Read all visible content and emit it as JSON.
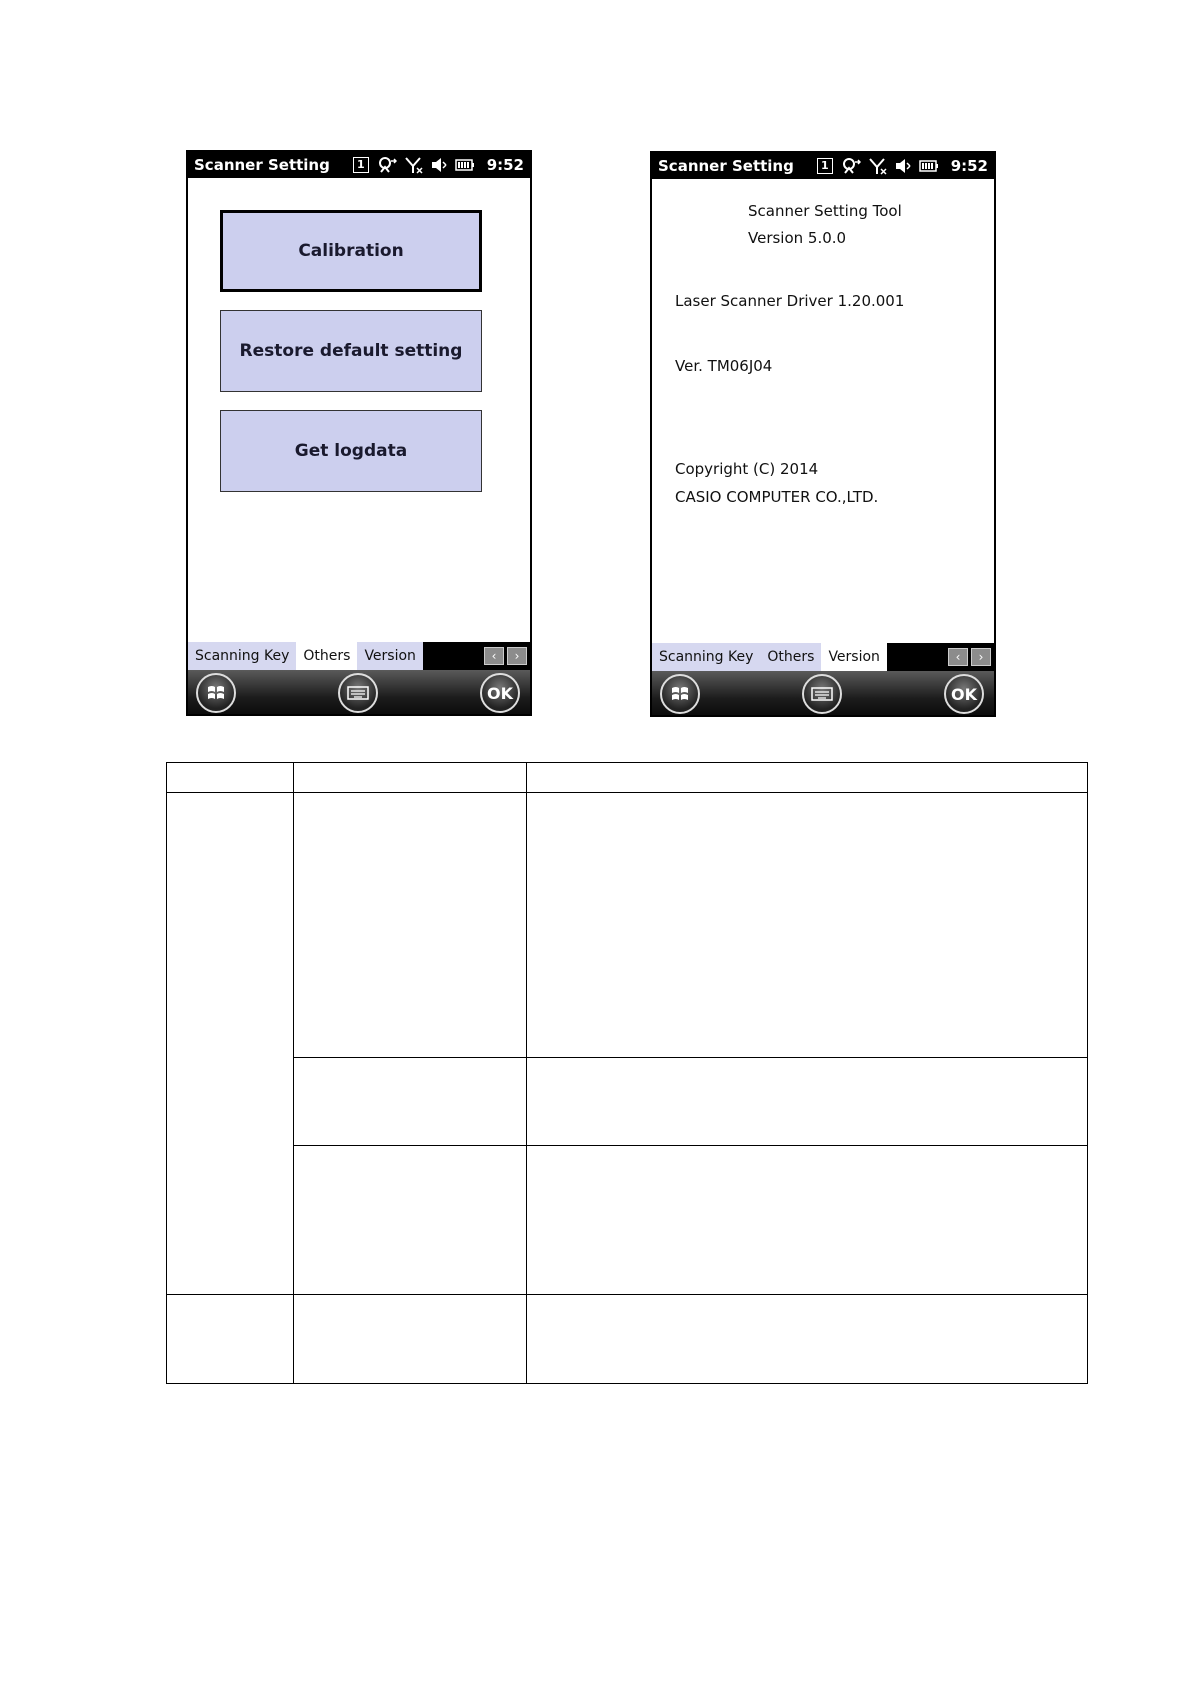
{
  "screens": {
    "left": {
      "status": {
        "title": "Scanner Setting",
        "indicator": "1",
        "time": "9:52"
      },
      "buttons": [
        "Calibration",
        "Restore default setting",
        "Get logdata"
      ],
      "tabs": [
        "Scanning Key",
        "Others",
        "Version"
      ],
      "active_tab": "Others",
      "softkeys": {
        "ok": "OK"
      }
    },
    "right": {
      "status": {
        "title": "Scanner Setting",
        "indicator": "1",
        "time": "9:52"
      },
      "info": {
        "tool_name": "Scanner Setting Tool",
        "tool_version": "Version 5.0.0",
        "driver": "Laser Scanner Driver 1.20.001",
        "ver": "Ver. TM06J04",
        "copyright": "Copyright (C) 2014",
        "company": "CASIO COMPUTER CO.,LTD."
      },
      "tabs": [
        "Scanning Key",
        "Others",
        "Version"
      ],
      "active_tab": "Version",
      "softkeys": {
        "ok": "OK"
      }
    }
  },
  "icons": {
    "status": [
      "connectivity-icon",
      "no-signal-icon",
      "speaker-muted-icon",
      "battery-icon"
    ],
    "softkeys": [
      "windows-start-icon",
      "keyboard-icon"
    ]
  },
  "colors": {
    "button_fill": "#cccfee",
    "tab_inactive": "#d6d8f0",
    "bar": "#000000"
  }
}
